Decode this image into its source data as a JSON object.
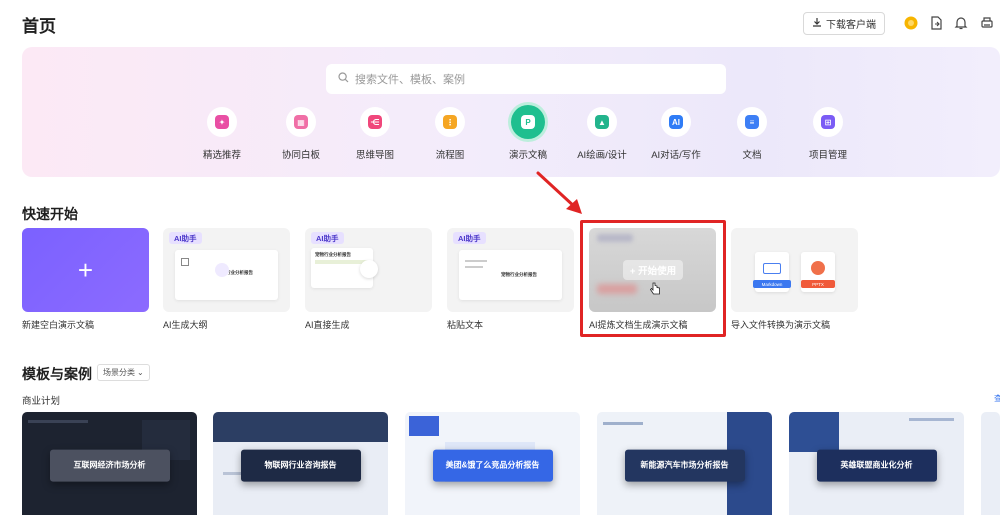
{
  "header": {
    "title": "首页",
    "download_label": "下载客户端"
  },
  "search": {
    "placeholder": "搜索文件、模板、案例"
  },
  "tools": [
    {
      "label": "精选推荐",
      "color": "#e94fa4"
    },
    {
      "label": "协同白板",
      "color": "#f06fa6"
    },
    {
      "label": "思维导图",
      "color": "#f0477b"
    },
    {
      "label": "流程图",
      "color": "#f5a623"
    },
    {
      "label": "演示文稿",
      "color": "#1fbf8f"
    },
    {
      "label": "AI绘画/设计",
      "color": "#22b48c"
    },
    {
      "label": "AI对话/写作",
      "color": "#2f7cf6"
    },
    {
      "label": "文档",
      "color": "#3d7ff5"
    },
    {
      "label": "项目管理",
      "color": "#7b5cf5"
    }
  ],
  "quick_start": {
    "title": "快速开始",
    "ai_tag": "AI助手",
    "start_label": "+ 开始使用",
    "mini_doc_title": "宠物行业分析报告",
    "format_markdown": "Markdown",
    "format_pptx": "PPTX",
    "cards": [
      {
        "label": "新建空白演示文稿"
      },
      {
        "label": "AI生成大纲"
      },
      {
        "label": "AI直接生成"
      },
      {
        "label": "粘贴文本"
      },
      {
        "label": "AI提炼文档生成演示文稿"
      },
      {
        "label": "导入文件转换为演示文稿"
      }
    ]
  },
  "templates": {
    "title": "模板与案例",
    "filter_label": "场景分类",
    "category": "商业计划",
    "items": [
      {
        "title": "互联网经济市场分析"
      },
      {
        "title": "物联网行业咨询报告"
      },
      {
        "title": "美团&饿了么竞品分析报告"
      },
      {
        "title": "新能源汽车市场分析报告"
      },
      {
        "title": "英雄联盟商业化分析"
      }
    ]
  }
}
